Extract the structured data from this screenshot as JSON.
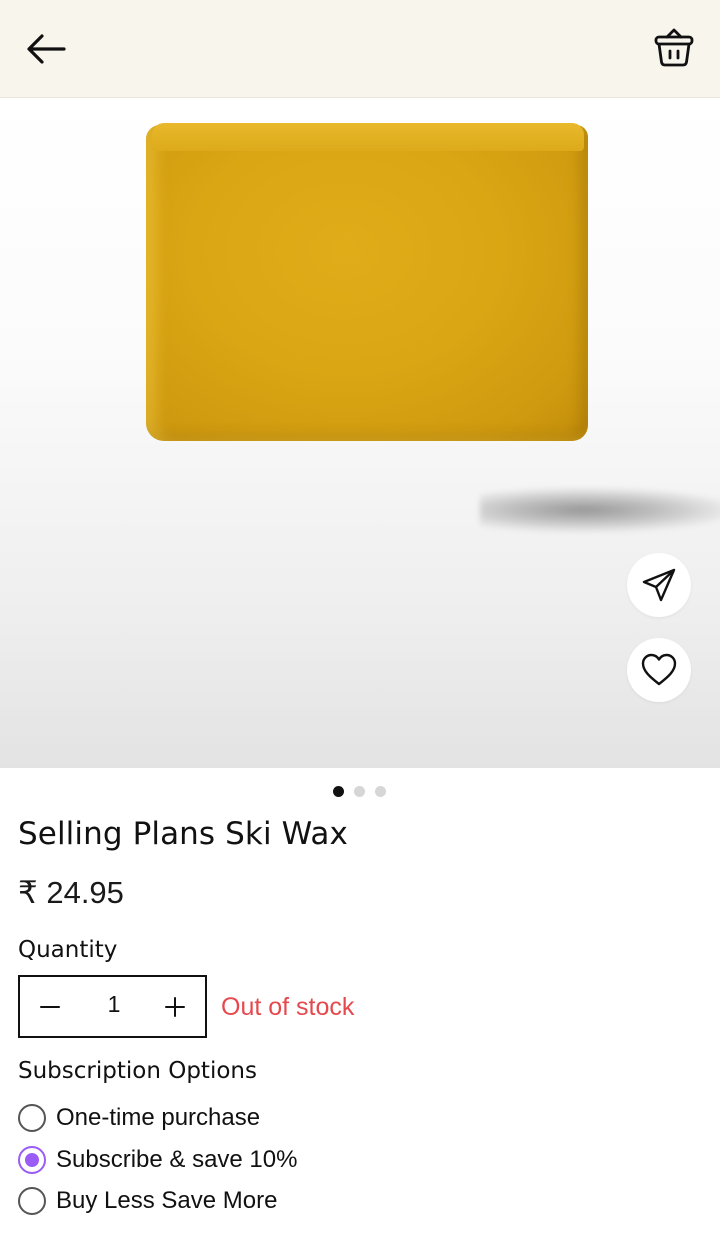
{
  "header": {
    "back_icon": "arrow-left-icon",
    "cart_icon": "basket-icon"
  },
  "gallery": {
    "image_description": "yellow ski wax bar",
    "share_icon": "send-icon",
    "wishlist_icon": "heart-icon",
    "pages": 3,
    "active_page": 1
  },
  "product": {
    "title": "Selling Plans Ski Wax",
    "price": "₹ 24.95"
  },
  "quantity": {
    "label": "Quantity",
    "value": "1",
    "decrement_icon": "minus-icon",
    "increment_icon": "plus-icon",
    "stock_status": "Out of stock"
  },
  "subscription": {
    "label": "Subscription Options",
    "options": [
      {
        "label": "One-time purchase",
        "selected": false
      },
      {
        "label": "Subscribe & save 10%",
        "selected": true
      },
      {
        "label": "Buy Less Save More",
        "selected": false
      }
    ]
  },
  "colors": {
    "header_bg": "#f8f5ec",
    "accent_purple": "#9b5cf6",
    "stock_red": "#e5484d",
    "dot_active": "#111111",
    "dot_inactive": "#d6d6d6"
  }
}
